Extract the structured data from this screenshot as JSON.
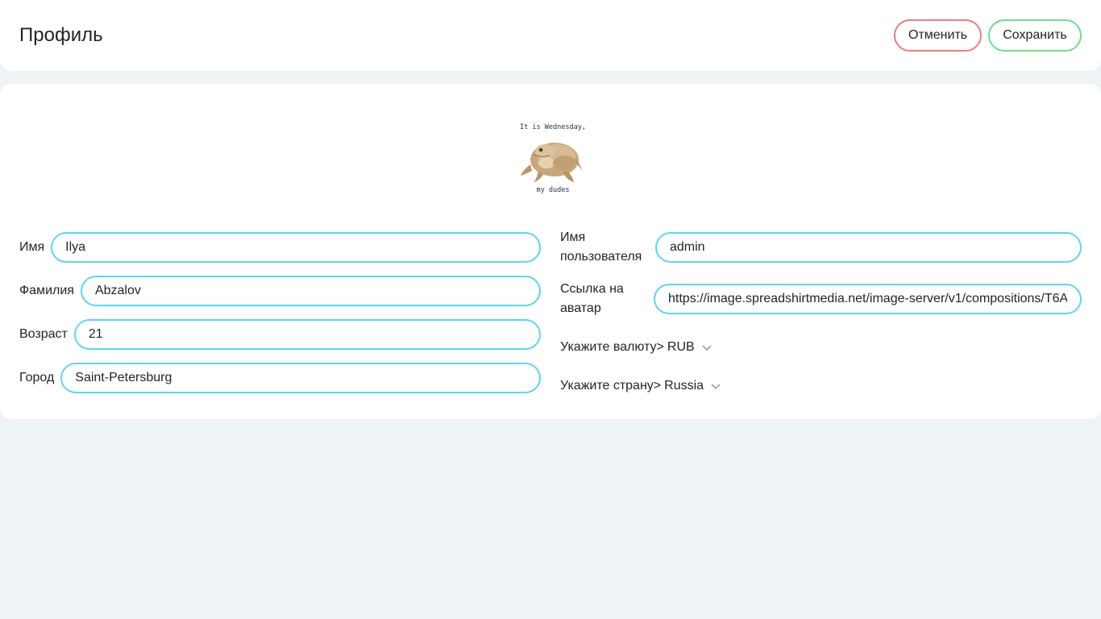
{
  "header": {
    "title": "Профиль",
    "cancel_label": "Отменить",
    "save_label": "Сохранить"
  },
  "avatar": {
    "caption_top": "It is Wednesday,",
    "caption_bottom": "my dudes"
  },
  "form": {
    "first_name": {
      "label": "Имя",
      "value": "Ilya"
    },
    "last_name": {
      "label": "Фамилия",
      "value": "Abzalov"
    },
    "age": {
      "label": "Возраст",
      "value": "21"
    },
    "city": {
      "label": "Город",
      "value": "Saint-Petersburg"
    },
    "username": {
      "label": "Имя пользователя",
      "value": "admin"
    },
    "avatar_url": {
      "label": "Ссылка на аватар",
      "value": "https://image.spreadshirtmedia.net/image-server/v1/compositions/T6A"
    },
    "currency": {
      "label": "Укажите валюту>",
      "value": "RUB"
    },
    "country": {
      "label": "Укажите страну>",
      "value": "Russia"
    }
  },
  "colors": {
    "background": "#eef3f6",
    "input_border": "#61d4ee",
    "cancel_border": "#ef7b7b",
    "save_border": "#6fdc8c"
  }
}
